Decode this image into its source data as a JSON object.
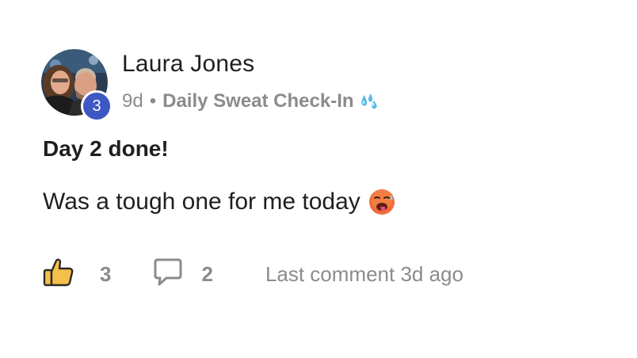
{
  "author": {
    "name": "Laura Jones",
    "level": "3"
  },
  "meta": {
    "age": "9d",
    "separator": "•",
    "channel": "Daily Sweat Check-In",
    "channel_icon": "sweat-droplets-icon"
  },
  "post": {
    "title": "Day 2 done!",
    "body": "Was a tough one for me today",
    "emoji_icon": "hot-face-icon"
  },
  "actions": {
    "like_icon": "thumbs-up-icon",
    "like_count": "3",
    "comment_icon": "speech-bubble-icon",
    "comment_count": "2",
    "last_comment": "Last comment 3d ago"
  },
  "colors": {
    "level_badge": "#3d57c4",
    "muted_text": "#8b8b8b",
    "like_icon": "#f5c04a"
  }
}
